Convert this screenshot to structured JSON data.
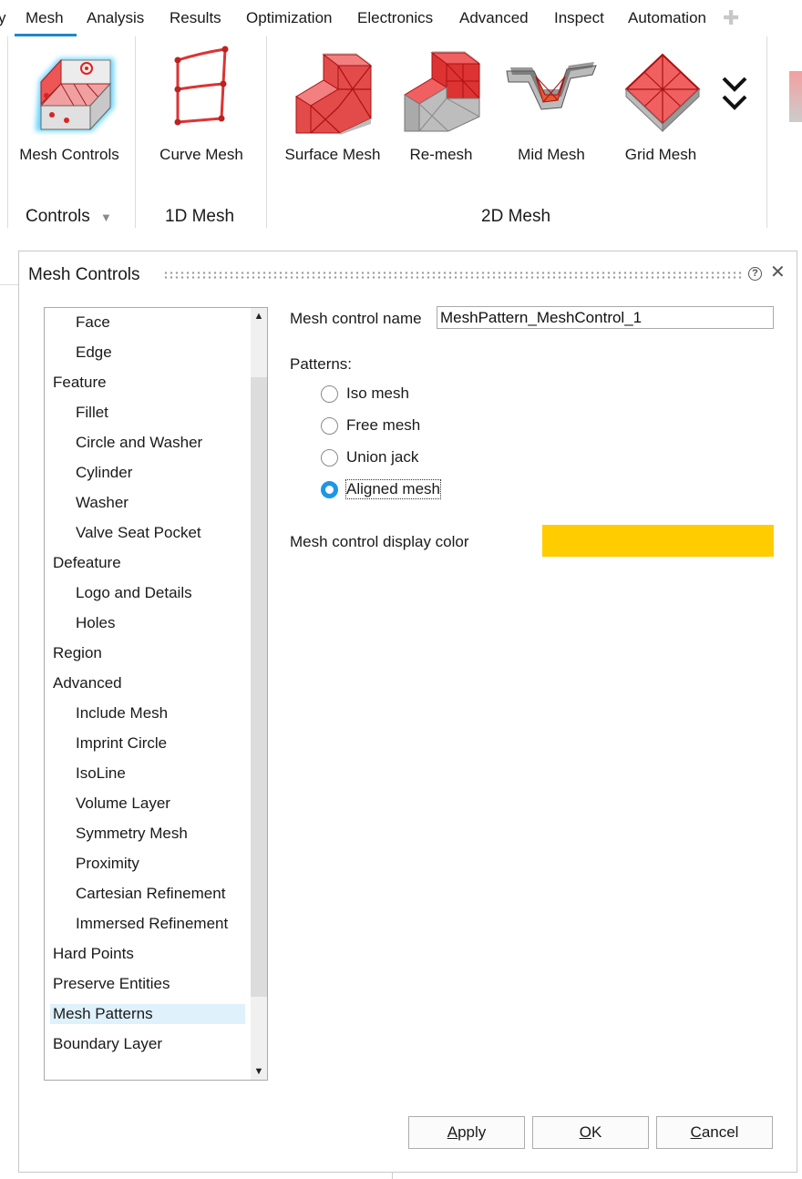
{
  "tabs": [
    "Mesh",
    "Analysis",
    "Results",
    "Optimization",
    "Electronics",
    "Advanced",
    "Inspect",
    "Automation"
  ],
  "tab_partial": "y",
  "active_tab": "Mesh",
  "ribbon": {
    "buttons": [
      {
        "label": "Mesh Controls",
        "icon": "mesh-controls-icon"
      },
      {
        "label": "Curve Mesh",
        "icon": "curve-mesh-icon"
      },
      {
        "label": "Surface Mesh",
        "icon": "surface-mesh-icon"
      },
      {
        "label": "Re-mesh",
        "icon": "remesh-icon"
      },
      {
        "label": "Mid Mesh",
        "icon": "mid-mesh-icon"
      },
      {
        "label": "Grid Mesh",
        "icon": "grid-mesh-icon"
      }
    ],
    "groups": [
      "Controls",
      "1D Mesh",
      "2D Mesh"
    ]
  },
  "dialog": {
    "title": "Mesh Controls",
    "tree": [
      {
        "label": "Face",
        "level": 1
      },
      {
        "label": "Edge",
        "level": 1
      },
      {
        "label": "Feature",
        "level": 0
      },
      {
        "label": "Fillet",
        "level": 1
      },
      {
        "label": "Circle and Washer",
        "level": 1
      },
      {
        "label": "Cylinder",
        "level": 1
      },
      {
        "label": "Washer",
        "level": 1
      },
      {
        "label": "Valve Seat Pocket",
        "level": 1
      },
      {
        "label": "Defeature",
        "level": 0
      },
      {
        "label": "Logo and Details",
        "level": 1
      },
      {
        "label": "Holes",
        "level": 1
      },
      {
        "label": "Region",
        "level": 0
      },
      {
        "label": "Advanced",
        "level": 0
      },
      {
        "label": "Include Mesh",
        "level": 1
      },
      {
        "label": "Imprint Circle",
        "level": 1
      },
      {
        "label": "IsoLine",
        "level": 1
      },
      {
        "label": "Volume Layer",
        "level": 1
      },
      {
        "label": "Symmetry Mesh",
        "level": 1
      },
      {
        "label": "Proximity",
        "level": 1
      },
      {
        "label": "Cartesian Refinement",
        "level": 1
      },
      {
        "label": "Immersed Refinement",
        "level": 1
      },
      {
        "label": "Hard Points",
        "level": 0
      },
      {
        "label": "Preserve Entities",
        "level": 0
      },
      {
        "label": "Mesh Patterns",
        "level": 0,
        "selected": true
      },
      {
        "label": "Boundary Layer",
        "level": 0
      }
    ],
    "name_label": "Mesh control name",
    "name_value": "MeshPattern_MeshControl_1",
    "patterns_label": "Patterns:",
    "patterns": [
      {
        "label": "Iso mesh",
        "checked": false
      },
      {
        "label": "Free mesh",
        "checked": false
      },
      {
        "label": "Union jack",
        "checked": false
      },
      {
        "label": "Aligned mesh",
        "checked": true
      }
    ],
    "color_label": "Mesh control display color",
    "color_value": "#FFCC00",
    "buttons": {
      "apply_mn": "A",
      "apply_rest": "pply",
      "ok_mn": "O",
      "ok_rest": "K",
      "cancel_mn": "C",
      "cancel_rest": "ancel"
    }
  }
}
